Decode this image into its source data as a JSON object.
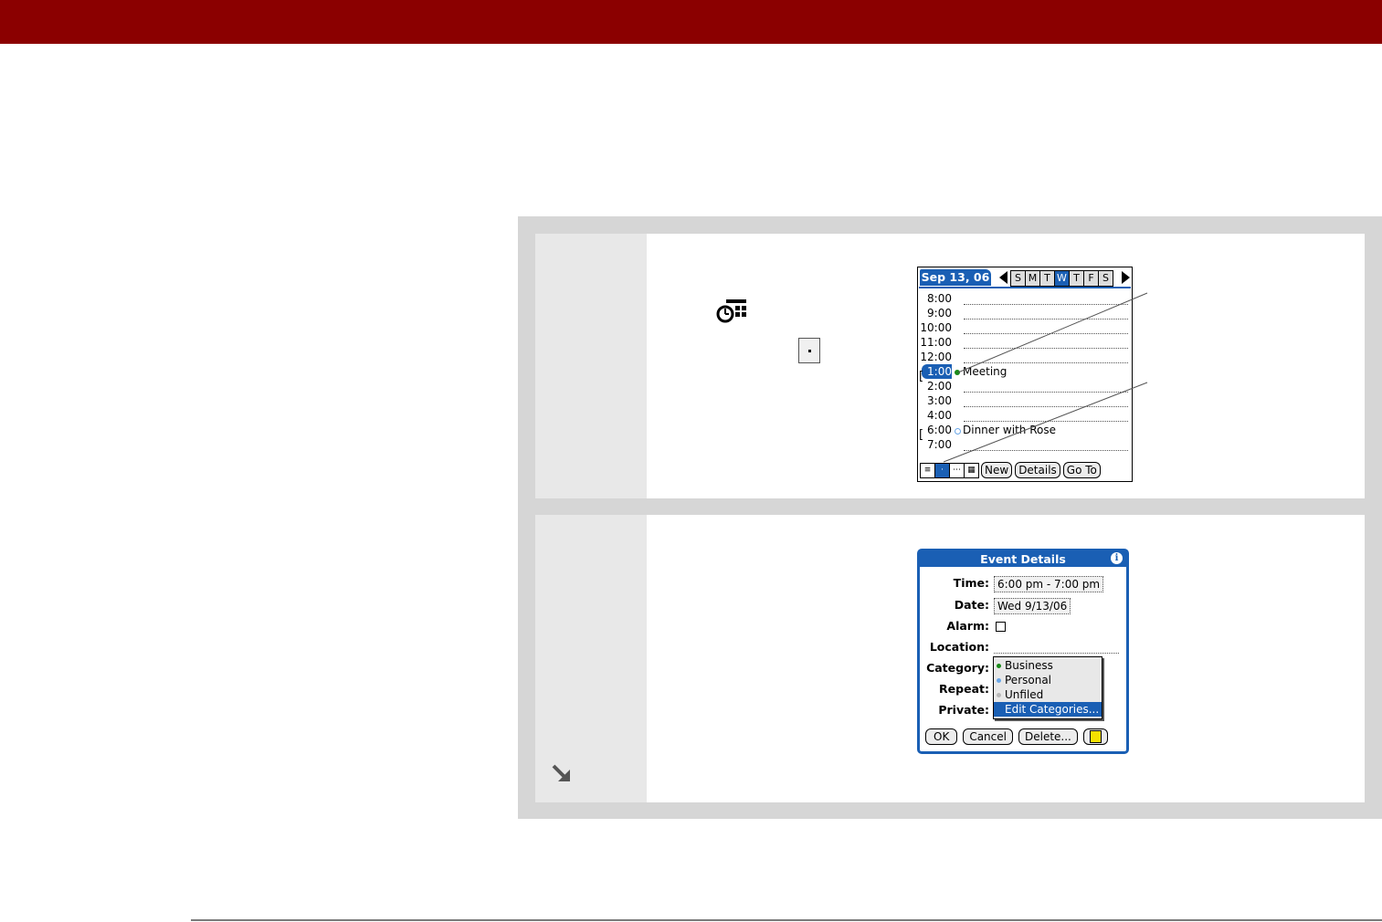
{
  "colors": {
    "header_bar": "#8b0000",
    "panel_bg": "#d6d6d6",
    "step_number_bg": "#e8e8e8",
    "palm_blue": "#1a5fb4",
    "bottom_rule": "#7a7a7a",
    "category_business": "#1a8a1a",
    "category_personal": "#6aa7e8",
    "category_unfiled": "#b8b8b8"
  },
  "icons": {
    "calendar_app_icon": "clock-grid-icon",
    "day_view_icon": "day-view-dot-icon",
    "more_arrow": "arrow-down-right-icon"
  },
  "day_view": {
    "date_label": "Sep 13, 06",
    "weekdays": [
      "S",
      "M",
      "T",
      "W",
      "T",
      "F",
      "S"
    ],
    "selected_weekday_index": 3,
    "times": [
      "8:00",
      "9:00",
      "10:00",
      "11:00",
      "12:00",
      "1:00",
      "2:00",
      "3:00",
      "4:00",
      "6:00",
      "7:00"
    ],
    "selected_time": "1:00",
    "events": [
      {
        "time": "1:00",
        "title": "Meeting",
        "category": "business"
      },
      {
        "time": "6:00",
        "title": "Dinner with Rose",
        "category": "personal"
      }
    ],
    "view_buttons": [
      "agenda",
      "day",
      "week",
      "month"
    ],
    "buttons": {
      "new": "New",
      "details": "Details",
      "goto": "Go To"
    }
  },
  "event_details": {
    "title": "Event Details",
    "labels": {
      "time": "Time:",
      "date": "Date:",
      "alarm": "Alarm:",
      "location": "Location:",
      "category": "Category:",
      "repeat": "Repeat:",
      "private": "Private:"
    },
    "time_value": "6:00 pm - 7:00 pm",
    "date_value": "Wed 9/13/06",
    "alarm_checked": false,
    "location_value": "",
    "category_options": [
      {
        "label": "Business",
        "color": "business"
      },
      {
        "label": "Personal",
        "color": "personal"
      },
      {
        "label": "Unfiled",
        "color": "unfiled"
      },
      {
        "label": "Edit Categories...",
        "color": ""
      }
    ],
    "selected_option_index": 3,
    "buttons": {
      "ok": "OK",
      "cancel": "Cancel",
      "delete": "Delete..."
    }
  }
}
